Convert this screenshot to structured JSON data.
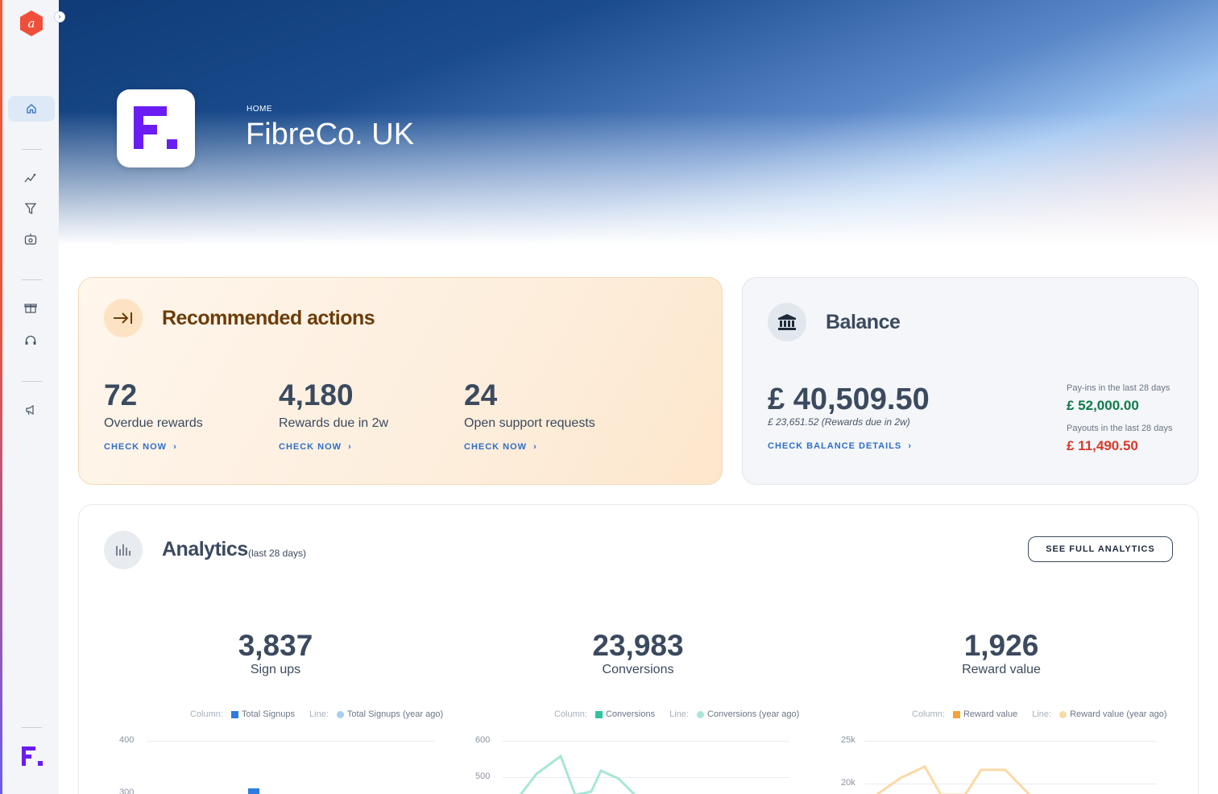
{
  "header": {
    "breadcrumb": "HOME",
    "title": "FibreCo. UK"
  },
  "sidebar": {
    "items": [
      {
        "name": "home-icon"
      },
      {
        "name": "analytics-icon"
      },
      {
        "name": "funnel-icon"
      },
      {
        "name": "rewards-box-icon"
      },
      {
        "name": "gift-icon"
      },
      {
        "name": "support-headset-icon"
      },
      {
        "name": "megaphone-icon"
      }
    ]
  },
  "recommended": {
    "title": "Recommended actions",
    "stats": [
      {
        "value": "72",
        "label": "Overdue rewards",
        "link": "CHECK NOW"
      },
      {
        "value": "4,180",
        "label": "Rewards due in 2w",
        "link": "CHECK NOW"
      },
      {
        "value": "24",
        "label": "Open support requests",
        "link": "CHECK NOW"
      }
    ]
  },
  "balance": {
    "title": "Balance",
    "amount": "£ 40,509.50",
    "sub": "£ 23,651.52 (Rewards due in 2w)",
    "link": "CHECK BALANCE DETAILS",
    "payins_label": "Pay-ins in the last 28 days",
    "payins_value": "£ 52,000.00",
    "payouts_label": "Payouts in the last 28 days",
    "payouts_value": "£ 11,490.50"
  },
  "analytics": {
    "title": "Analytics",
    "subtitle": "(last 28 days)",
    "button": "SEE FULL ANALYTICS",
    "metrics": [
      {
        "value": "3,837",
        "label": "Sign ups",
        "legend_col_key": "Column:",
        "legend_col": "Total Signups",
        "legend_line_key": "Line:",
        "legend_line": "Total Signups (year ago)",
        "ticks": [
          "400",
          "300"
        ]
      },
      {
        "value": "23,983",
        "label": "Conversions",
        "legend_col_key": "Column:",
        "legend_col": "Conversions",
        "legend_line_key": "Line:",
        "legend_line": "Conversions (year ago)",
        "ticks": [
          "600",
          "500"
        ]
      },
      {
        "value": "1,926",
        "label": "Reward value",
        "legend_col_key": "Column:",
        "legend_col": "Reward value",
        "legend_line_key": "Line:",
        "legend_line": "Reward value (year ago)",
        "ticks": [
          "25k",
          "20k"
        ]
      }
    ]
  },
  "colors": {
    "signups": "#2f7be0",
    "signups_line": "#a9cdf5",
    "conversions": "#2ec4a0",
    "conversions_line": "#a8e6d6",
    "reward": "#f5a33a",
    "reward_line": "#fbd9a6",
    "payins": "#0f7a4a",
    "payouts": "#d63a2a"
  }
}
